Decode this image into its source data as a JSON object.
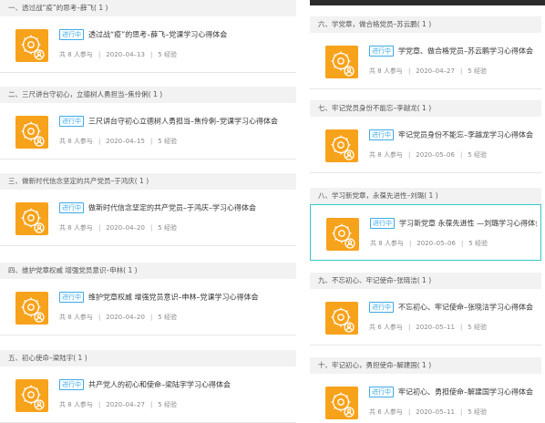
{
  "badge_label": "进行中",
  "labels": {
    "participants_prefix": "共",
    "participants_suffix": "人参与",
    "exp_suffix": "经验",
    "separator": "|"
  },
  "colors": {
    "badge": "#3da9e8",
    "thumbnail": "#f7a21b",
    "highlight_border": "#37c6c9"
  },
  "left_column": [
    {
      "section": "一、透过战“疫”的思考–薛飞( 1 )",
      "title": "透过战“疫”的思考–薛飞–党课学习心得体会",
      "participants": "8",
      "date": "2020–04–13",
      "exp": "5"
    },
    {
      "section": "二、三尺讲台守初心，立德树人勇担当–焦伶俐( 1 )",
      "title": "三尺讲台守初心立德树人勇担当–焦伶俐–党课学习心得体会",
      "participants": "8",
      "date": "2020–04–15",
      "exp": "5"
    },
    {
      "section": "三、做新时代信念坚定的共产党员–于鸿庆( 1 )",
      "title": "做新时代信念坚定的共产党员–于鸿庆–学习心得体会",
      "participants": "8",
      "date": "2020–04–20",
      "exp": "5"
    },
    {
      "section": "四、维护党章权威 增强党员意识–申林( 1 )",
      "title": "维护党章权威 增强党员意识–申林–党课学习心得体会",
      "participants": "8",
      "date": "2020–04–20",
      "exp": "5"
    },
    {
      "section": "五、初心使命–梁陆宇( 1 )",
      "title": "共产党人的初心和使命–梁陆宇学习心得体会",
      "participants": "8",
      "date": "2020–04–27",
      "exp": "5"
    }
  ],
  "right_column": [
    {
      "section": "六、学党章，做合格党员–苏云鹏( 1 )",
      "title": "学党章、做合格党员–苏云鹏学习心得体会",
      "participants": "8",
      "date": "2020–04–27",
      "exp": "5"
    },
    {
      "section": "七、牢记党员身份不能忘–李越龙( 1 )",
      "title": "牢记党员身份不能忘–李越龙学习心得体会",
      "participants": "8",
      "date": "2020–05–06",
      "exp": "5"
    },
    {
      "section": "八、学习新党章，永葆先进性–刘璐( 1 )",
      "title": "学习新党章 永葆先进性 —刘璐学习心得体会",
      "participants": "8",
      "date": "2020–05–06",
      "exp": "5"
    },
    {
      "section": "九、不忘初心、牢记使命–张晓洁( 1 )",
      "title": "不忘初心、牢记使命–张晓洁学习心得体会",
      "participants": "6",
      "date": "2020–05–11",
      "exp": "5"
    },
    {
      "section": "十、牢记初心，勇担使命–解建国( 1 )",
      "title": "牢记初心、勇担使命–解建国学习心得体会",
      "participants": "6",
      "date": "2020–05–11",
      "exp": "5"
    }
  ]
}
